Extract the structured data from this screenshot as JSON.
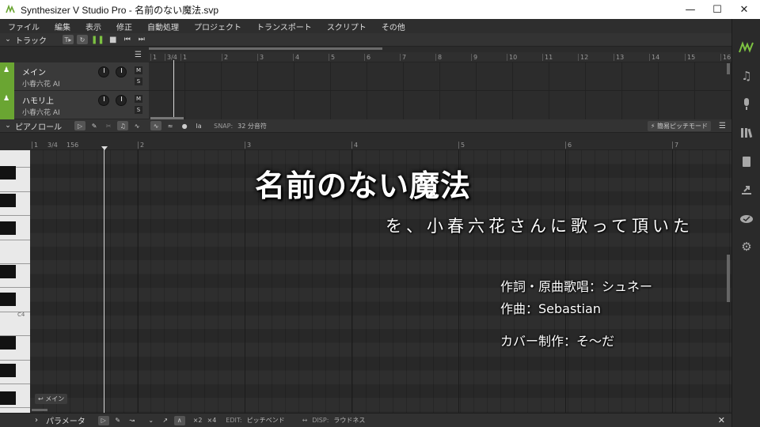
{
  "window": {
    "title": "Synthesizer V Studio Pro - 名前のない魔法.svp"
  },
  "menu": [
    "ファイル",
    "編集",
    "表示",
    "修正",
    "自動処理",
    "プロジェクト",
    "トランスポート",
    "スクリプト",
    "その他"
  ],
  "track_section": {
    "label": "トラック"
  },
  "tracks": [
    {
      "name": "メイン",
      "singer": "小春六花 AI",
      "m": "M",
      "s": "S"
    },
    {
      "name": "ハモリ上",
      "singer": "小春六花 AI",
      "m": "M",
      "s": "S"
    }
  ],
  "arrange_ruler": [
    "1",
    "3/4",
    "1",
    "2",
    "3",
    "4",
    "5",
    "6",
    "7",
    "8",
    "9",
    "10",
    "11",
    "12",
    "13",
    "14",
    "15",
    "16",
    "17"
  ],
  "piano_roll": {
    "label": "ピアノロール",
    "snap_label": "SNAP:",
    "snap_value": "32 分音符",
    "pitch_mode": "簡易ピッチモード",
    "lyric_btn": "la",
    "track_tag": "メイン",
    "c4_label": "C4"
  },
  "pr_ruler": [
    "1",
    "3/4",
    "156",
    "2",
    "3",
    "4",
    "5",
    "6",
    "7"
  ],
  "parameters": {
    "label": "パラメータ",
    "x2": "×2",
    "x4": "×4",
    "edit_label": "EDIT:",
    "edit_value": "ピッチベンド",
    "disp_label": "DISP:",
    "disp_value": "ラウドネス"
  },
  "overlay": {
    "title": "名前のない魔法",
    "subtitle": "を、小春六花さんに歌って頂いた",
    "credits": [
      "作詞・原曲歌唱：シュネー",
      "作曲：Sebastian",
      "カバー制作：そ～だ"
    ]
  },
  "colors": {
    "track_color": "#6aa532",
    "accent": "#7dc242"
  }
}
